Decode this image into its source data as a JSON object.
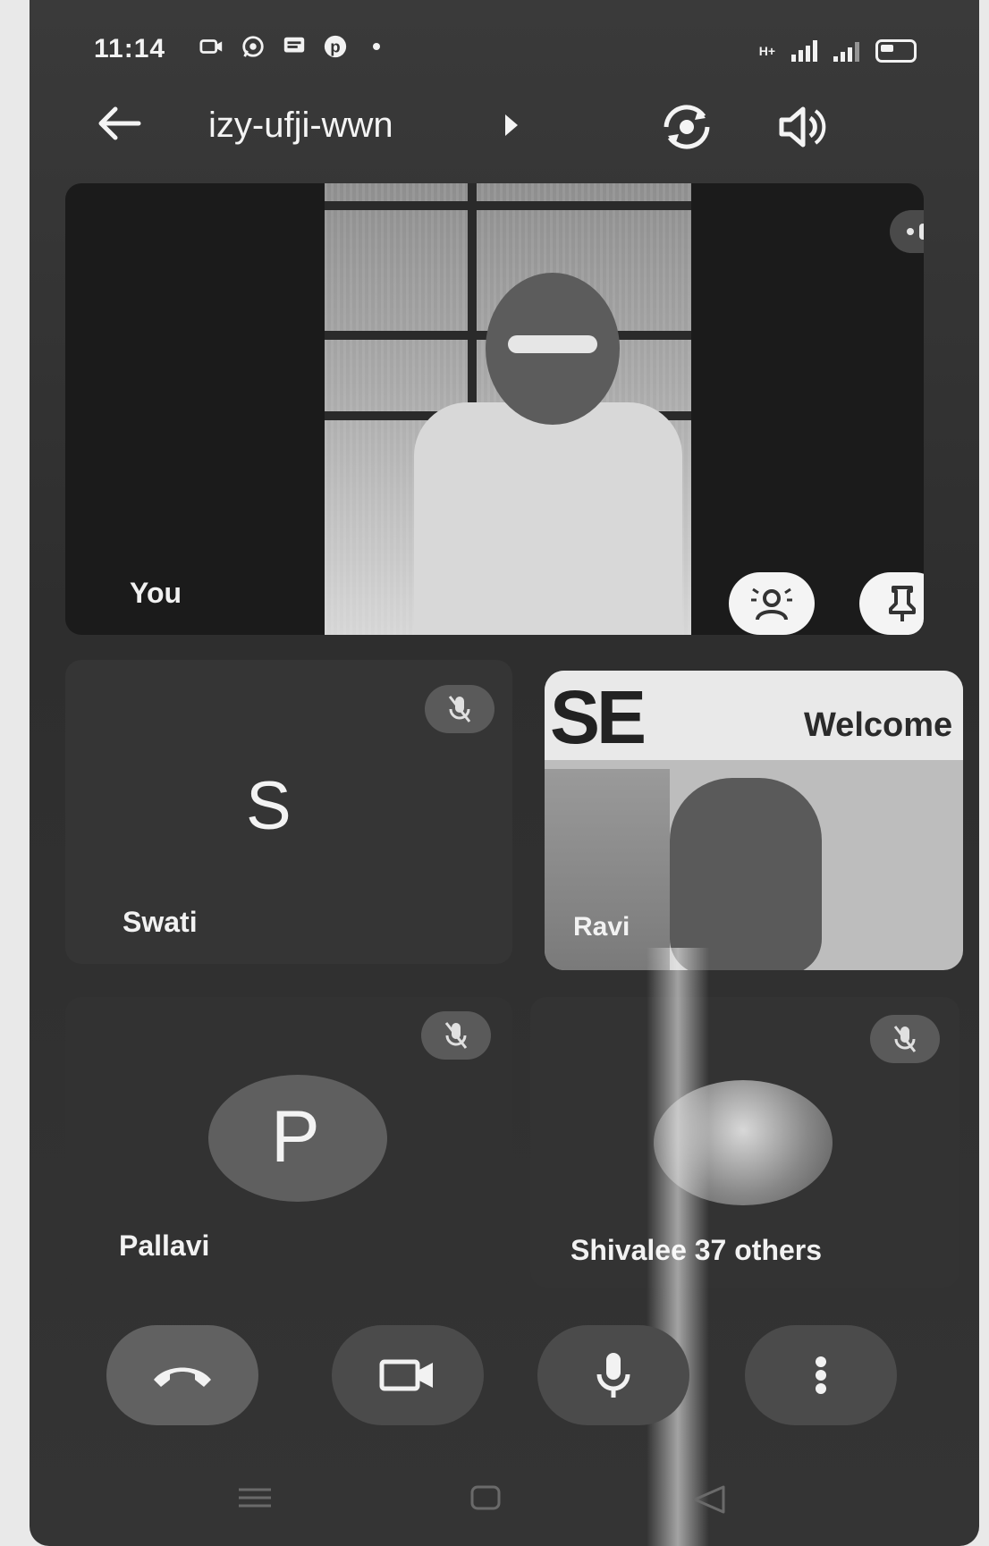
{
  "status_bar": {
    "time": "11:14",
    "network_label": "H+"
  },
  "header": {
    "meeting_code": "izy-ufji-wwn"
  },
  "tiles": {
    "self_label": "You",
    "swati": {
      "initial": "S",
      "name": "Swati"
    },
    "ravi": {
      "name": "Ravi",
      "banner_left": "SE",
      "banner_right": "Welcome"
    },
    "pallavi": {
      "initial": "P",
      "name": "Pallavi"
    },
    "others": {
      "label": "Shivalee 37 others"
    }
  },
  "icons": {
    "back": "arrow-left-icon",
    "switch_camera": "switch-camera-icon",
    "speaker": "speaker-icon",
    "audio_level": "audio-level-icon",
    "effects": "effects-icon",
    "pin": "pin-icon",
    "mic_off": "mic-off-icon",
    "end_call": "phone-hangup-icon",
    "video": "video-camera-icon",
    "mic": "microphone-icon",
    "more": "more-vertical-icon"
  },
  "colors": {
    "background": "#2f2f2f",
    "tile": "#353535",
    "control": "#4b4b4b",
    "foreground": "#f2f2f2"
  }
}
